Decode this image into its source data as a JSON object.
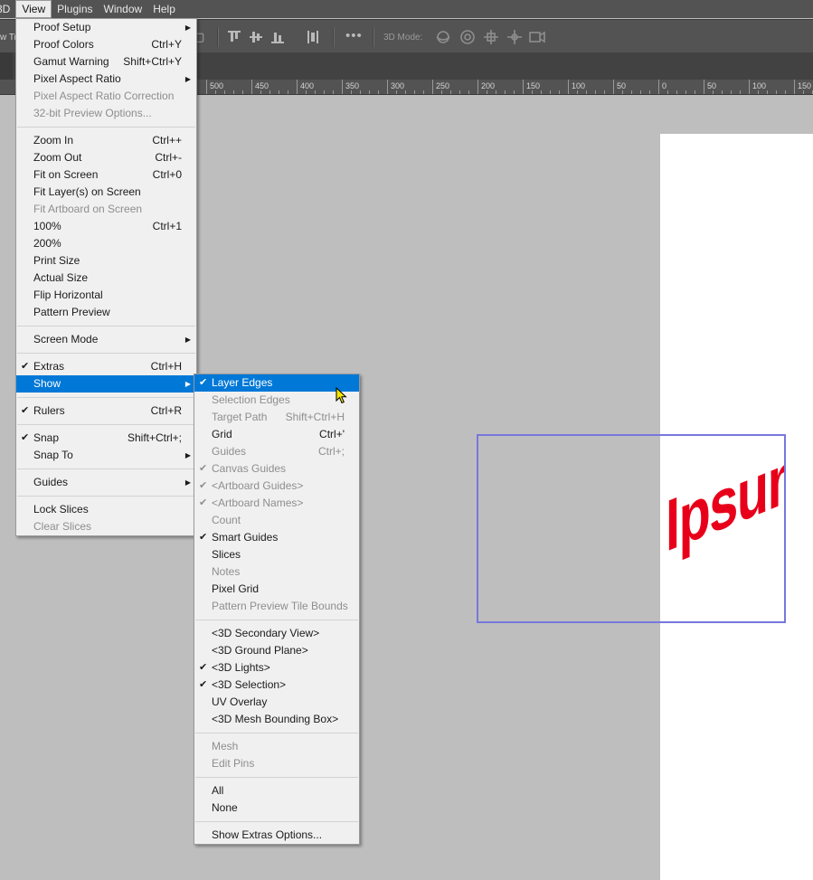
{
  "menubar": {
    "items": [
      "3D",
      "View",
      "Plugins",
      "Window",
      "Help"
    ],
    "active": "View"
  },
  "options_bar": {
    "left_text": "w Tr",
    "mode_label": "3D Mode:"
  },
  "ruler": {
    "labels": [
      "500",
      "450",
      "400",
      "350",
      "300",
      "250",
      "200",
      "150",
      "100",
      "50",
      "0",
      "50",
      "100",
      "150"
    ]
  },
  "canvas": {
    "layer_text": "Ipsum",
    "text_color": "#e8001a",
    "layer_edge_color": "#7777dd"
  },
  "view_menu": {
    "groups": [
      [
        {
          "label": "Proof Setup",
          "submenu": true
        },
        {
          "label": "Proof Colors",
          "shortcut": "Ctrl+Y"
        },
        {
          "label": "Gamut Warning",
          "shortcut": "Shift+Ctrl+Y"
        },
        {
          "label": "Pixel Aspect Ratio",
          "submenu": true
        },
        {
          "label": "Pixel Aspect Ratio Correction",
          "disabled": true
        },
        {
          "label": "32-bit Preview Options...",
          "disabled": true
        }
      ],
      [
        {
          "label": "Zoom In",
          "shortcut": "Ctrl++"
        },
        {
          "label": "Zoom Out",
          "shortcut": "Ctrl+-"
        },
        {
          "label": "Fit on Screen",
          "shortcut": "Ctrl+0"
        },
        {
          "label": "Fit Layer(s) on Screen"
        },
        {
          "label": "Fit Artboard on Screen",
          "disabled": true
        },
        {
          "label": "100%",
          "shortcut": "Ctrl+1"
        },
        {
          "label": "200%"
        },
        {
          "label": "Print Size"
        },
        {
          "label": "Actual Size"
        },
        {
          "label": "Flip Horizontal"
        },
        {
          "label": "Pattern Preview"
        }
      ],
      [
        {
          "label": "Screen Mode",
          "submenu": true
        }
      ],
      [
        {
          "label": "Extras",
          "shortcut": "Ctrl+H",
          "checked": true
        },
        {
          "label": "Show",
          "submenu": true,
          "highlighted": true
        }
      ],
      [
        {
          "label": "Rulers",
          "shortcut": "Ctrl+R",
          "checked": true
        }
      ],
      [
        {
          "label": "Snap",
          "shortcut": "Shift+Ctrl+;",
          "checked": true
        },
        {
          "label": "Snap To",
          "submenu": true
        }
      ],
      [
        {
          "label": "Guides",
          "submenu": true
        }
      ],
      [
        {
          "label": "Lock Slices"
        },
        {
          "label": "Clear Slices",
          "disabled": true
        }
      ]
    ]
  },
  "show_menu": {
    "groups": [
      [
        {
          "label": "Layer Edges",
          "checked": true,
          "highlighted": true
        },
        {
          "label": "Selection Edges",
          "disabled": true
        },
        {
          "label": "Target Path",
          "shortcut": "Shift+Ctrl+H",
          "disabled": true
        },
        {
          "label": "Grid",
          "shortcut": "Ctrl+'"
        },
        {
          "label": "Guides",
          "shortcut": "Ctrl+;",
          "disabled": true
        },
        {
          "label": "Canvas Guides",
          "checked": true,
          "disabled": true
        },
        {
          "label": "<Artboard Guides>",
          "checked": true,
          "disabled": true
        },
        {
          "label": "<Artboard Names>",
          "checked": true,
          "disabled": true
        },
        {
          "label": "Count",
          "disabled": true
        },
        {
          "label": "Smart Guides",
          "checked": true
        },
        {
          "label": "Slices"
        },
        {
          "label": "Notes",
          "disabled": true
        },
        {
          "label": "Pixel Grid"
        },
        {
          "label": "Pattern Preview Tile Bounds",
          "disabled": true
        }
      ],
      [
        {
          "label": "<3D Secondary View>"
        },
        {
          "label": "<3D Ground Plane>"
        },
        {
          "label": "<3D Lights>",
          "checked": true
        },
        {
          "label": "<3D Selection>",
          "checked": true
        },
        {
          "label": "UV Overlay"
        },
        {
          "label": "<3D Mesh Bounding Box>"
        }
      ],
      [
        {
          "label": "Mesh",
          "disabled": true
        },
        {
          "label": "Edit Pins",
          "disabled": true
        }
      ],
      [
        {
          "label": "All"
        },
        {
          "label": "None"
        }
      ],
      [
        {
          "label": "Show Extras Options..."
        }
      ]
    ]
  },
  "icons": {
    "submenu_arrow": "submenu-arrow-icon",
    "check": "check-icon",
    "cursor": "mouse-pointer-icon"
  }
}
